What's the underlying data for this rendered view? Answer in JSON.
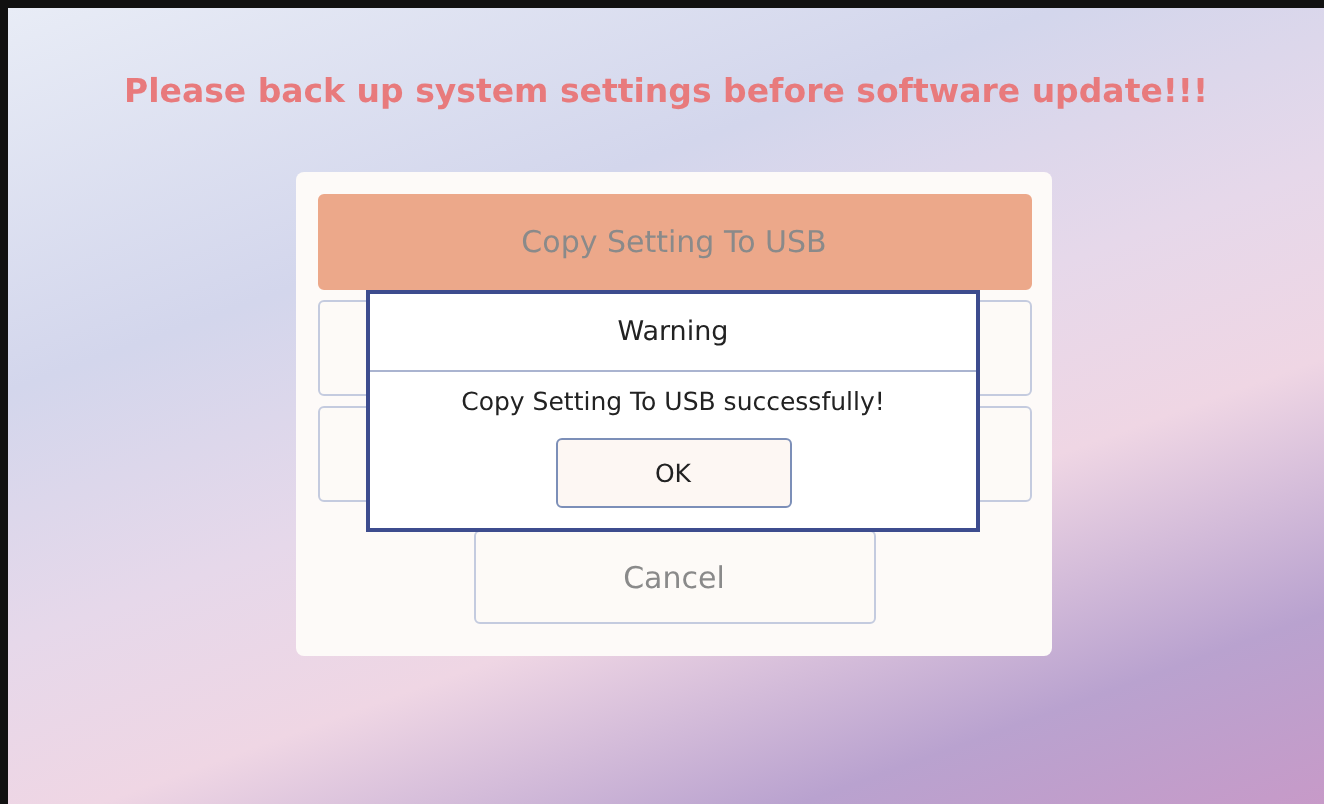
{
  "notice": "Please back up system settings before software update!!!",
  "menu": {
    "buttons": [
      {
        "kind": "action",
        "label": "Copy Setting To USB",
        "selected": true
      },
      {
        "kind": "covered",
        "selected": false
      },
      {
        "kind": "covered",
        "selected": false
      },
      {
        "kind": "cancel",
        "label": "Cancel",
        "selected": false
      }
    ]
  },
  "dialog": {
    "title": "Warning",
    "message": "Copy Setting To USB successfully!",
    "button": "OK"
  }
}
